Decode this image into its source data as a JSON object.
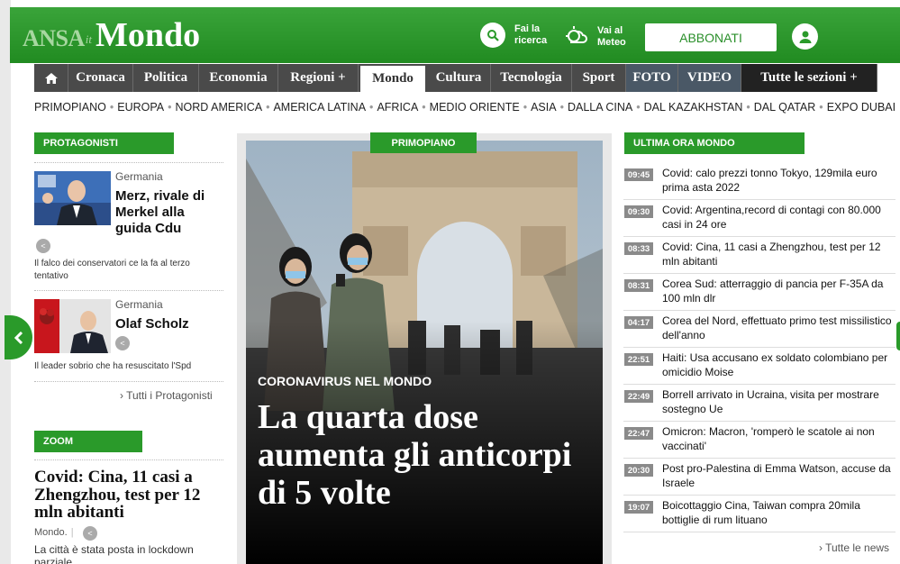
{
  "header": {
    "logo_ansa": "ANSA",
    "logo_it": "it",
    "logo_section": "Mondo",
    "search_label_1": "Fai la",
    "search_label_2": "ricerca",
    "meteo_label_1": "Vai al",
    "meteo_label_2": "Meteo",
    "subscribe_label": "ABBONATI",
    "brand_color": "#2a9a2a"
  },
  "nav": {
    "items": [
      "Cronaca",
      "Politica",
      "Economia",
      "Regioni +",
      "Mondo",
      "Cultura",
      "Tecnologia",
      "Sport",
      "FOTO",
      "VIDEO",
      "Tutte le sezioni +"
    ],
    "active": "Mondo"
  },
  "subnav": [
    "PRIMOPIANO",
    "EUROPA",
    "NORD AMERICA",
    "AMERICA LATINA",
    "AFRICA",
    "MEDIO ORIENTE",
    "ASIA",
    "DALLA CINA",
    "DAL KAZAKHSTAN",
    "DAL QATAR",
    "EXPO DUBAI"
  ],
  "protagonisti": {
    "tag": "PROTAGONISTI",
    "cards": [
      {
        "category": "Germania",
        "name_1": "Merz, rivale di",
        "name_2": "Merkel alla",
        "name_3": "guida Cdu",
        "desc": "Il falco dei conservatori ce la fa al terzo tentativo"
      },
      {
        "category": "Germania",
        "name_1": "Olaf Scholz",
        "desc": "Il leader sobrio che ha resuscitato l'Spd"
      }
    ],
    "more": "Tutti i Protagonisti"
  },
  "zoom": {
    "tag": "ZOOM",
    "title": "Covid: Cina, 11 casi a Zhengzhou, test per 12 mln abitanti",
    "source": "Mondo.",
    "desc": "La città è stata posta in lockdown parziale"
  },
  "hero": {
    "tag": "PRIMOPIANO",
    "kicker": "CORONAVIRUS NEL MONDO",
    "title": "La quarta dose aumenta gli anticorpi di 5 volte"
  },
  "ultima_ora": {
    "tag": "ULTIMA ORA MONDO",
    "items": [
      {
        "time": "09:45",
        "text": "Covid: calo prezzi tonno Tokyo, 129mila euro prima asta 2022"
      },
      {
        "time": "09:30",
        "text": "Covid: Argentina,record di contagi con 80.000 casi in 24 ore"
      },
      {
        "time": "08:33",
        "text": "Covid: Cina, 11 casi a Zhengzhou, test per 12 mln abitanti"
      },
      {
        "time": "08:31",
        "text": "Corea Sud: atterraggio di pancia per F-35A da 100 mln dlr"
      },
      {
        "time": "04:17",
        "text": "Corea del Nord, effettuato primo test missilistico dell'anno"
      },
      {
        "time": "22:51",
        "text": "Haiti: Usa accusano ex soldato colombiano per omicidio Moise"
      },
      {
        "time": "22:49",
        "text": "Borrell arrivato in Ucraina, visita per mostrare sostegno Ue"
      },
      {
        "time": "22:47",
        "text": "Omicron: Macron, 'romperò le scatole ai non vaccinati'"
      },
      {
        "time": "20:30",
        "text": "Post pro-Palestina di Emma Watson, accuse da Israele"
      },
      {
        "time": "19:07",
        "text": "Boicottaggio Cina, Taiwan compra 20mila bottiglie di rum lituano"
      }
    ],
    "more": "Tutte le news"
  }
}
